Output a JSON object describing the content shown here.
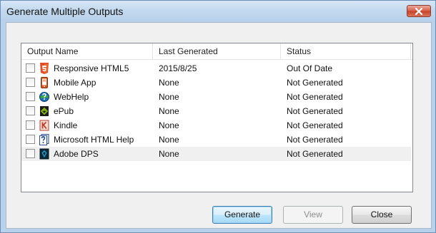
{
  "window": {
    "title": "Generate Multiple Outputs"
  },
  "list": {
    "columns": [
      "Output Name",
      "Last Generated",
      "Status"
    ],
    "rows": [
      {
        "name": "Responsive HTML5",
        "last_generated": "2015/8/25",
        "status": "Out Of Date",
        "checked": false,
        "icon": "html5-icon"
      },
      {
        "name": "Mobile App",
        "last_generated": "None",
        "status": "Not Generated",
        "checked": false,
        "icon": "mobile-app-icon"
      },
      {
        "name": "WebHelp",
        "last_generated": "None",
        "status": "Not Generated",
        "checked": false,
        "icon": "webhelp-icon"
      },
      {
        "name": "ePub",
        "last_generated": "None",
        "status": "Not Generated",
        "checked": false,
        "icon": "epub-icon"
      },
      {
        "name": "Kindle",
        "last_generated": "None",
        "status": "Not Generated",
        "checked": false,
        "icon": "kindle-icon"
      },
      {
        "name": "Microsoft HTML Help",
        "last_generated": "None",
        "status": "Not Generated",
        "checked": false,
        "icon": "html-help-icon"
      },
      {
        "name": "Adobe DPS",
        "last_generated": "None",
        "status": "Not Generated",
        "checked": false,
        "icon": "adobe-dps-icon"
      }
    ]
  },
  "buttons": {
    "generate": "Generate",
    "view": "View",
    "close": "Close"
  },
  "colors": {
    "frame": "#b9d1ea",
    "client": "#f0f0f0",
    "close_button": "#c7432b",
    "default_button_border": "#3c7fb1",
    "highlight_row": "#f0f0f0"
  }
}
